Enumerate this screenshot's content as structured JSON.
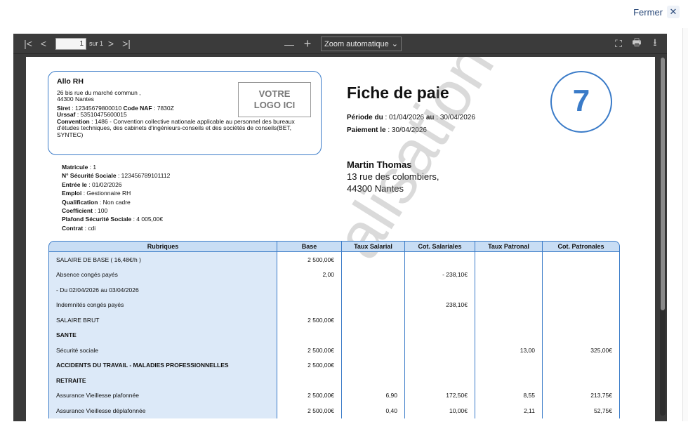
{
  "header": {
    "close_label": "Fermer"
  },
  "toolbar": {
    "page_value": "1",
    "of_label": "sur 1",
    "zoom_label": "Zoom automatique"
  },
  "doc": {
    "company": {
      "name": "Allo RH",
      "address1": "26 bis rue du marché commun ,",
      "address2": "44300 Nantes",
      "siret_label": "Siret",
      "siret_value": " : 12345679800010 ",
      "naf_label": "Code NAF",
      "naf_value": " : 7830Z",
      "urssaf_label": "Urssaf",
      "urssaf_value": " : 53510475600015",
      "convention_label": "Convention",
      "convention_value": "  : 1486 - Convention collective nationale applicable au personnel des bureaux d'études techniques, des cabinets d'ingénieurs-conseils et des sociétés de conseils(BET, SYNTEC)"
    },
    "logo_text_1": "VOTRE",
    "logo_text_2": "LOGO ICI",
    "title": "Fiche de paie",
    "periode_label": "Période du",
    "periode_from": " : 01/04/2026 ",
    "periode_au": "au",
    "periode_to": " : 30/04/2026",
    "paiement_label": "Paiement le",
    "paiement_value": " : 30/04/2026",
    "number": "7",
    "employee": [
      {
        "label": "Matricule",
        "value": " : 1"
      },
      {
        "label": "N° Sécurité Sociale",
        "value": " : 123456789101112"
      },
      {
        "label": "Entrée le",
        "value": " : 01/02/2026"
      },
      {
        "label": "Emploi",
        "value": " : Gestionnaire RH"
      },
      {
        "label": "Qualification",
        "value": " : Non cadre"
      },
      {
        "label": "Coefficient",
        "value": " : 100"
      },
      {
        "label": "Plafond Sécurité Sociale",
        "value": " : 4 005,00€"
      },
      {
        "label": "Contrat",
        "value": " : cdi"
      }
    ],
    "employee_name": "Martin Thomas",
    "employee_addr1": "13 rue des colombiers,",
    "employee_addr2": "44300 Nantes",
    "watermark": "alisation",
    "table": {
      "headers": [
        "Rubriques",
        "Base",
        "Taux Salarial",
        "Cot. Salariales",
        "Taux Patronal",
        "Cot. Patronales"
      ],
      "rows": [
        [
          "SALAIRE DE BASE ( 16,48€/h )",
          "2 500,00€",
          "",
          "",
          "",
          ""
        ],
        [
          "Absence congés payés",
          "2,00",
          "",
          "- 238,10€",
          "",
          ""
        ],
        [
          "- Du 02/04/2026 au 03/04/2026",
          "",
          "",
          "",
          "",
          ""
        ],
        [
          "Indemnités congés payés",
          "",
          "",
          "238,10€",
          "",
          ""
        ],
        [
          "SALAIRE BRUT",
          "2 500,00€",
          "",
          "",
          "",
          ""
        ],
        [
          "SANTE",
          "",
          "",
          "",
          "",
          ""
        ],
        [
          "Sécurité sociale",
          "2 500,00€",
          "",
          "",
          "13,00",
          "325,00€"
        ],
        [
          "ACCIDENTS DU TRAVAIL - MALADIES PROFESSIONNELLES",
          "2 500,00€",
          "",
          "",
          "",
          ""
        ],
        [
          "RETRAITE",
          "",
          "",
          "",
          "",
          ""
        ],
        [
          "Assurance Vieillesse plafonnée",
          "2 500,00€",
          "6,90",
          "172,50€",
          "8,55",
          "213,75€"
        ],
        [
          "Assurance Vieillesse déplafonnée",
          "2 500,00€",
          "0,40",
          "10,00€",
          "2,11",
          "52,75€"
        ]
      ]
    }
  }
}
